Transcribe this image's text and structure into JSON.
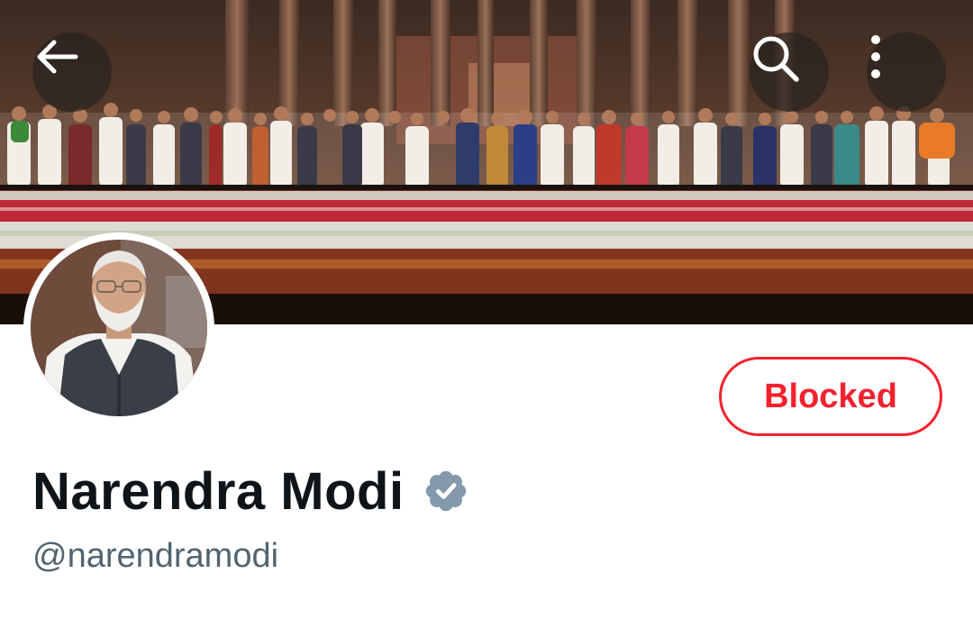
{
  "header": {
    "back_icon": "arrow-left-icon",
    "search_icon": "search-icon",
    "more_icon": "more-vertical-icon",
    "overlay_color": "#2a2220"
  },
  "banner": {
    "description_icon": "banner-image"
  },
  "profile": {
    "display_name": "Narendra Modi",
    "verified_icon": "verified-badge-icon",
    "verified_color": "#829aab",
    "handle": "@narendramodi"
  },
  "actions": {
    "blocked_label": "Blocked",
    "blocked_color": "#f4212e"
  }
}
